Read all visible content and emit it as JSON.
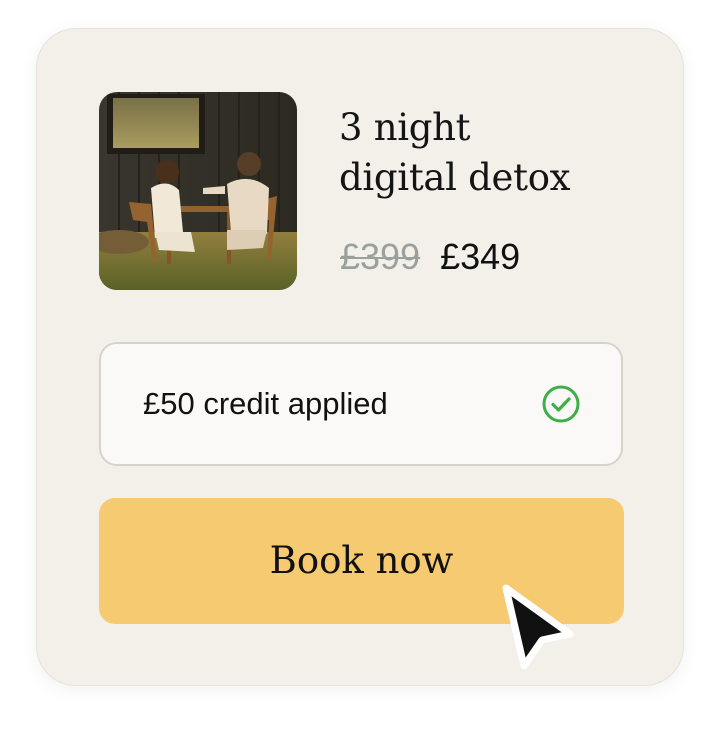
{
  "offer": {
    "title_line1": "3 night",
    "title_line2": "digital detox",
    "original_price": "£399",
    "price": "£349"
  },
  "credit": {
    "text": "£50 credit applied",
    "icon": "check-circle-icon",
    "icon_color": "#3dae48"
  },
  "cta": {
    "label": "Book now",
    "color": "#f5ca71"
  },
  "image": {
    "subject": "photo"
  }
}
